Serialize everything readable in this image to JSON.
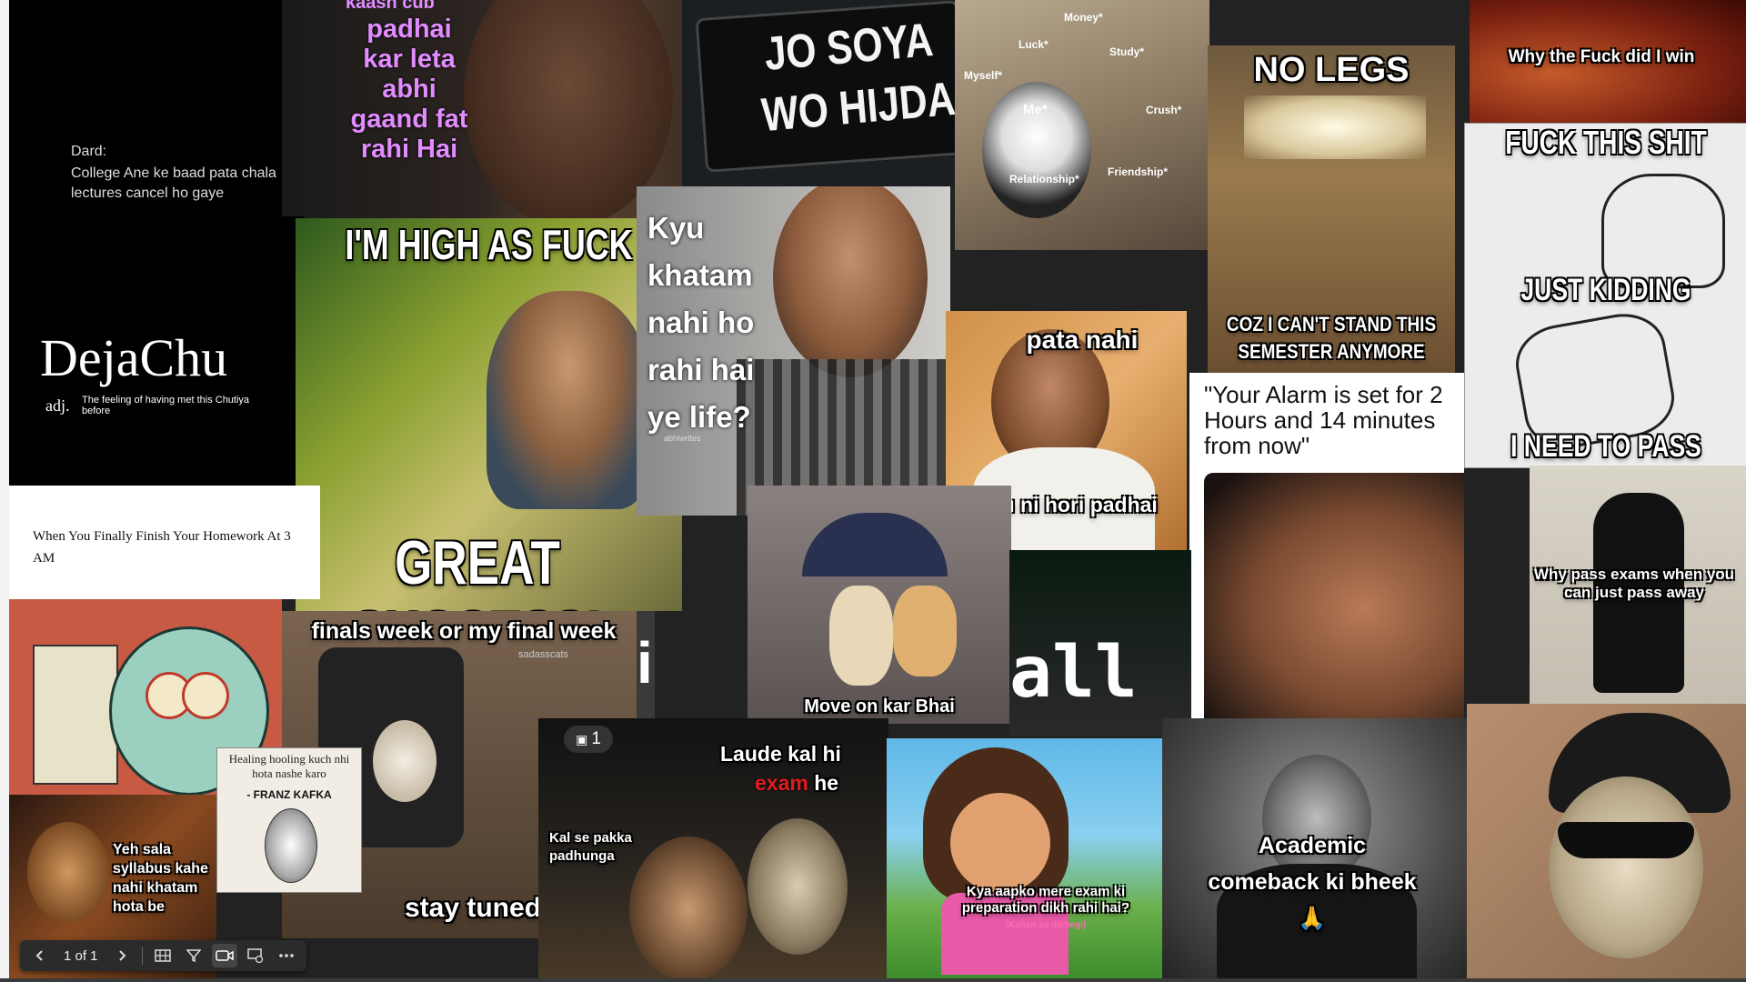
{
  "viewer": {
    "page_indicator": "1 of 1",
    "icons": {
      "prev": "chevron-left-icon",
      "next": "chevron-right-icon",
      "grid": "grid-icon",
      "filter": "filter-icon",
      "video": "video-icon",
      "present": "present-icon",
      "more": "more-icon"
    }
  },
  "tiles": {
    "dard": {
      "label": "Dard:",
      "text": "College Ane ke baad pata chala lectures cancel ho gaye"
    },
    "padhai": {
      "text": "padhai kar leta abhi gaand fat rahi Hai",
      "top_fragment": "kaash cub"
    },
    "jo_soya": {
      "line1": "JO SOYA",
      "line2": "WO HIJDA"
    },
    "cat": {
      "labels": [
        "Money*",
        "Luck*",
        "Study*",
        "Myself*",
        "Me*",
        "Crush*",
        "Relationship*",
        "Friendship*"
      ]
    },
    "no_legs": {
      "top": "NO LEGS",
      "bottom": "COZ I CAN'T STAND THIS SEMESTER ANYMORE"
    },
    "sperm": {
      "text": "Why the Fuck did I win"
    },
    "rage": {
      "top": "FUCK THIS SHIT",
      "middle": "JUST KIDDING",
      "bottom": "I NEED TO PASS"
    },
    "dejachu": {
      "title": "DejaChu",
      "pos": "adj.",
      "def": "The feeling of having met this Chutiya before"
    },
    "borat": {
      "top": "I'M HIGH AS FUCK",
      "bottom": "GREAT SUCCESS!"
    },
    "kyu": {
      "text": "Kyu khatam nahi ho rahi hai ye life?",
      "watermark": "abhiwrites"
    },
    "pata_nahi": {
      "top": "pata nahi",
      "bottom": "Kyu ni hori padhai"
    },
    "alarm": {
      "text": "\"Your Alarm is set for 2 Hours and 14 minutes from now\""
    },
    "homework": {
      "text": "When You Finally Finish Your Homework At 3 AM"
    },
    "finals": {
      "top": "finals week or my final week",
      "bottom": "stay tuned",
      "watermark": "sadasscats"
    },
    "move_on": {
      "text": "Move on kar Bhai"
    },
    "i_all": {
      "left": "i",
      "right": "all"
    },
    "pass_away": {
      "text": "Why pass exams when you can just pass away"
    },
    "kafka": {
      "quote": "Healing hooling kuch nhi hota nashe karo",
      "author": "- FRANZ KAFKA"
    },
    "yeh_sala": {
      "text": "Yeh sala syllabus kahe nahi khatam hota be"
    },
    "laude": {
      "badge": "1",
      "line1": "Laude kal hi",
      "exam": "exam",
      "he": "he",
      "left": "Kal se pakka padhunga"
    },
    "dora": {
      "text": "Kya aapko mere exam ki preparation dikh rahi hai?",
      "sub": "(Kahan se dikhegi)"
    },
    "academic": {
      "text": "Academic comeback ki bheek 🙏"
    }
  }
}
